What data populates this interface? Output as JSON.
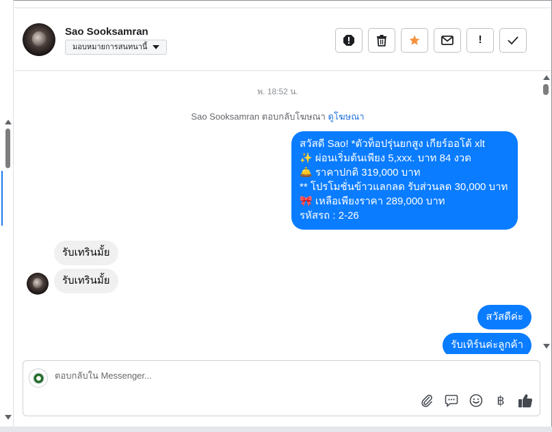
{
  "header": {
    "contact_name": "Sao Sooksamran",
    "assign_label": "มอบหมายการสนทนานี้"
  },
  "actions": [
    {
      "name": "spam-icon",
      "label": "Mark as spam"
    },
    {
      "name": "trash-icon",
      "label": "Delete"
    },
    {
      "name": "star-icon",
      "label": "Star",
      "color": "#f5923e"
    },
    {
      "name": "envelope-icon",
      "label": "Mark unread"
    },
    {
      "name": "exclamation-icon",
      "label": "!"
    },
    {
      "name": "check-icon",
      "label": "Done"
    }
  ],
  "thread": {
    "timestamp": "พ. 18:52 น.",
    "reply_note": "Sao Sooksamran ตอบกลับโฆษณา",
    "reply_link": "ดูโฆษณา",
    "ad_message_lines": [
      "สวัสดี Sao! *ตัวท็อปรุ่นยกสูง เกียร์ออโต้ xlt",
      "✨  ผ่อนเริ่มต้นเพียง 5,xxx. บาท 84 งวด",
      "🛎️ ราคาปกติ 319,000 บาท",
      "** โปรโมชั่นข้าวแลกลด รับส่วนลด 30,000 บาท",
      "🎀  เหลือเพียงราคา 289,000 บาท",
      " รหัสรถ : 2-26"
    ],
    "incoming": [
      "รับเทรินมั้ย",
      "รับเทรินมั้ย"
    ],
    "outgoing": [
      "สวัสดีค่ะ",
      "รับเทิร์นค่ะลูกค้า"
    ]
  },
  "composer": {
    "placeholder": "ตอบกลับใน Messenger..."
  },
  "colors": {
    "outgoing_bubble": "#0a7cff",
    "incoming_bubble": "#f0f0f0",
    "link": "#216fdb"
  }
}
